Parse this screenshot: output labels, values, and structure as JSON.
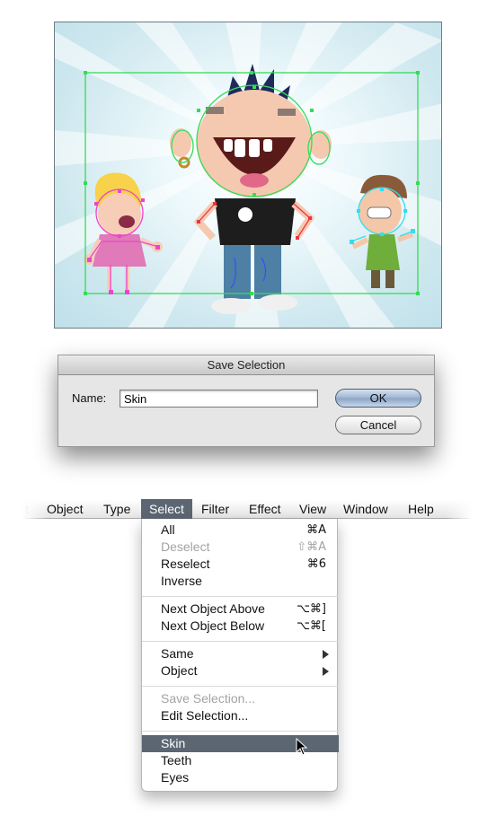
{
  "dialog": {
    "title": "Save Selection",
    "name_label": "Name:",
    "name_value": "Skin",
    "ok_label": "OK",
    "cancel_label": "Cancel"
  },
  "menubar": {
    "partial_item": "t",
    "items": [
      "Object",
      "Type",
      "Select",
      "Filter",
      "Effect",
      "View",
      "Window",
      "Help"
    ],
    "active": "Select"
  },
  "select_menu": {
    "groups": [
      [
        {
          "label": "All",
          "shortcut": "⌘A"
        },
        {
          "label": "Deselect",
          "shortcut": "⇧⌘A",
          "disabled": true
        },
        {
          "label": "Reselect",
          "shortcut": "⌘6"
        },
        {
          "label": "Inverse",
          "shortcut": ""
        }
      ],
      [
        {
          "label": "Next Object Above",
          "shortcut": "⌥⌘]"
        },
        {
          "label": "Next Object Below",
          "shortcut": "⌥⌘["
        }
      ],
      [
        {
          "label": "Same",
          "submenu": true
        },
        {
          "label": "Object",
          "submenu": true
        }
      ],
      [
        {
          "label": "Save Selection...",
          "disabled": true
        },
        {
          "label": "Edit Selection..."
        }
      ],
      [
        {
          "label": "Skin",
          "highlighted": true
        },
        {
          "label": "Teeth"
        },
        {
          "label": "Eyes"
        }
      ]
    ]
  },
  "icons": {
    "submenu": "chevron-right-icon",
    "cursor": "mouse-pointer-icon"
  },
  "colors": {
    "menu_highlight": "#5c6673",
    "selection_green": "#33dd55",
    "selection_magenta": "#ee44cc",
    "selection_cyan": "#33ddee",
    "selection_blue": "#3355ee",
    "selection_red": "#ee3344"
  }
}
